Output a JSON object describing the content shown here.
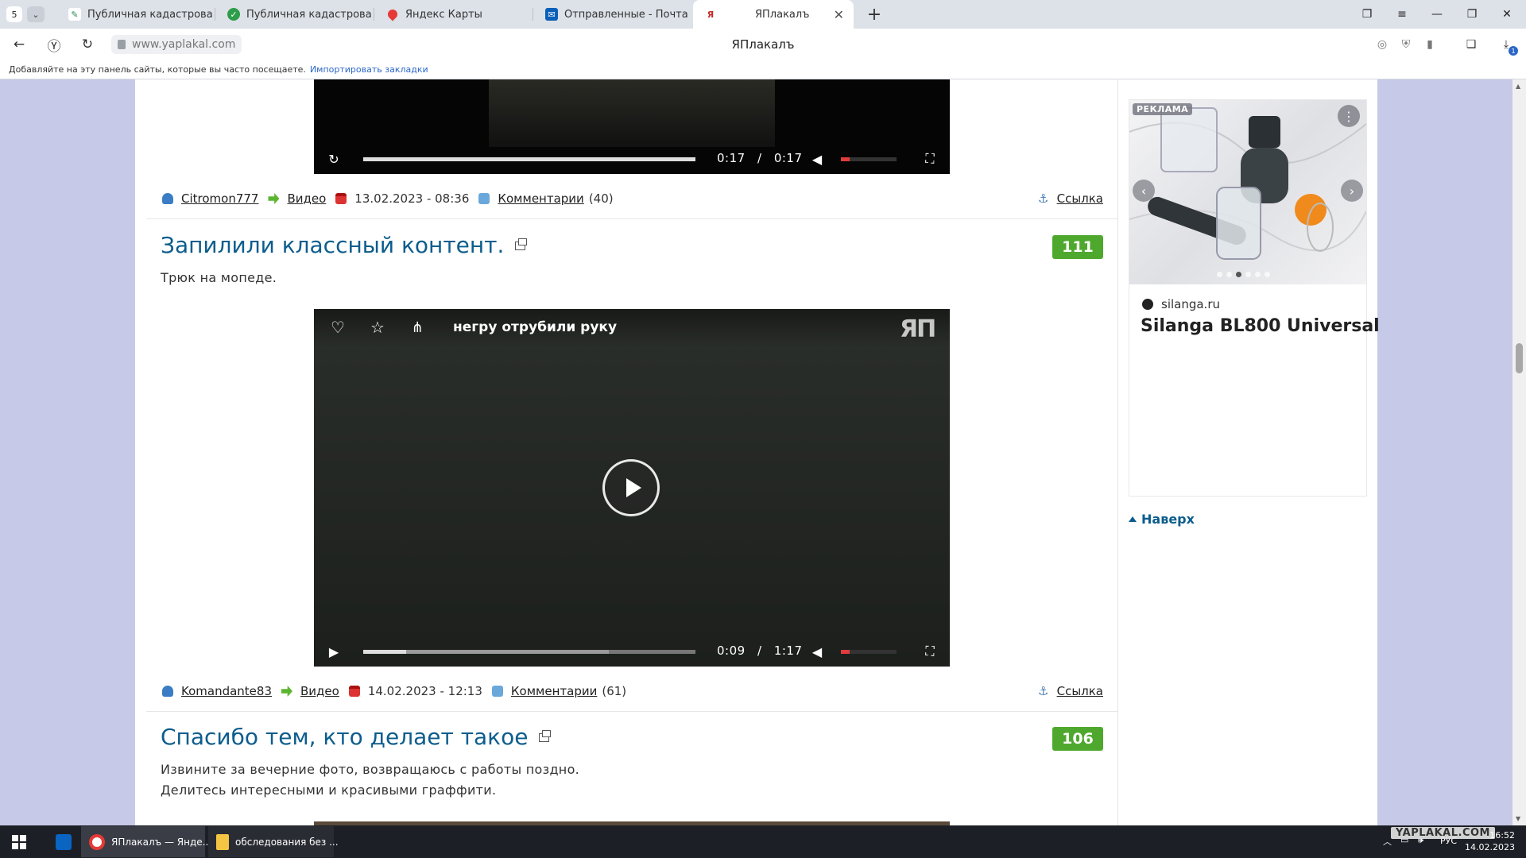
{
  "browser": {
    "tab_count": "5",
    "tabs": [
      {
        "label": "Публичная кадастровая к"
      },
      {
        "label": "Публичная кадастровая к"
      },
      {
        "label": "Яндекс Карты"
      },
      {
        "label": "Отправленные - Почта M"
      },
      {
        "label": "ЯПлакалъ"
      }
    ],
    "url": "www.yaplakal.com",
    "page_title": "ЯПлакалъ",
    "downloads_badge": "1",
    "bookmarks_hint": "Добавляйте на эту панель сайты, которые вы часто посещаете.",
    "bookmarks_import": "Импортировать закладки"
  },
  "posts": [
    {
      "video": {
        "time_current": "0:17",
        "time_sep": "/",
        "time_total": "0:17",
        "progress": 1.0,
        "volume": 0.15
      },
      "author": "Citromon777",
      "category": "Видео",
      "date": "13.02.2023 - 08:36",
      "comments_label": "Комментарии",
      "comments_count": "(40)",
      "link_label": "Ссылка"
    },
    {
      "title": "Запилили классный контент.",
      "rating": "111",
      "text": [
        "Трюк на мопеде."
      ],
      "video": {
        "overlay_title": "негру отрубили руку",
        "watermark": "ЯП",
        "time_current": "0:09",
        "time_sep": "/",
        "time_total": "1:17",
        "progress": 0.13,
        "buffered": 0.74,
        "volume": 0.15
      },
      "author": "Komandante83",
      "category": "Видео",
      "date": "14.02.2023 - 12:13",
      "comments_label": "Комментарии",
      "comments_count": "(61)",
      "link_label": "Ссылка"
    },
    {
      "title": "Спасибо тем, кто делает такое",
      "rating": "106",
      "text": [
        "Извините за вечерние фото, возвращаюсь с работы поздно.",
        "Делитесь интересными и красивыми граффити."
      ]
    }
  ],
  "sidebar": {
    "ad": {
      "badge": "РЕКЛАМА",
      "domain": "silanga.ru",
      "headline": "Silanga BL800 Universal",
      "slide_count": 6,
      "active_slide": 3
    },
    "to_top": "Наверх"
  },
  "taskbar": {
    "items": [
      {
        "label": "ЯПлакалъ — Янде..."
      },
      {
        "label": "обследования без ..."
      }
    ],
    "tray_lang": "РУС",
    "clock_time": "16:52",
    "clock_date": "14.02.2023",
    "watermark": "YAPLAKAL.COM"
  }
}
